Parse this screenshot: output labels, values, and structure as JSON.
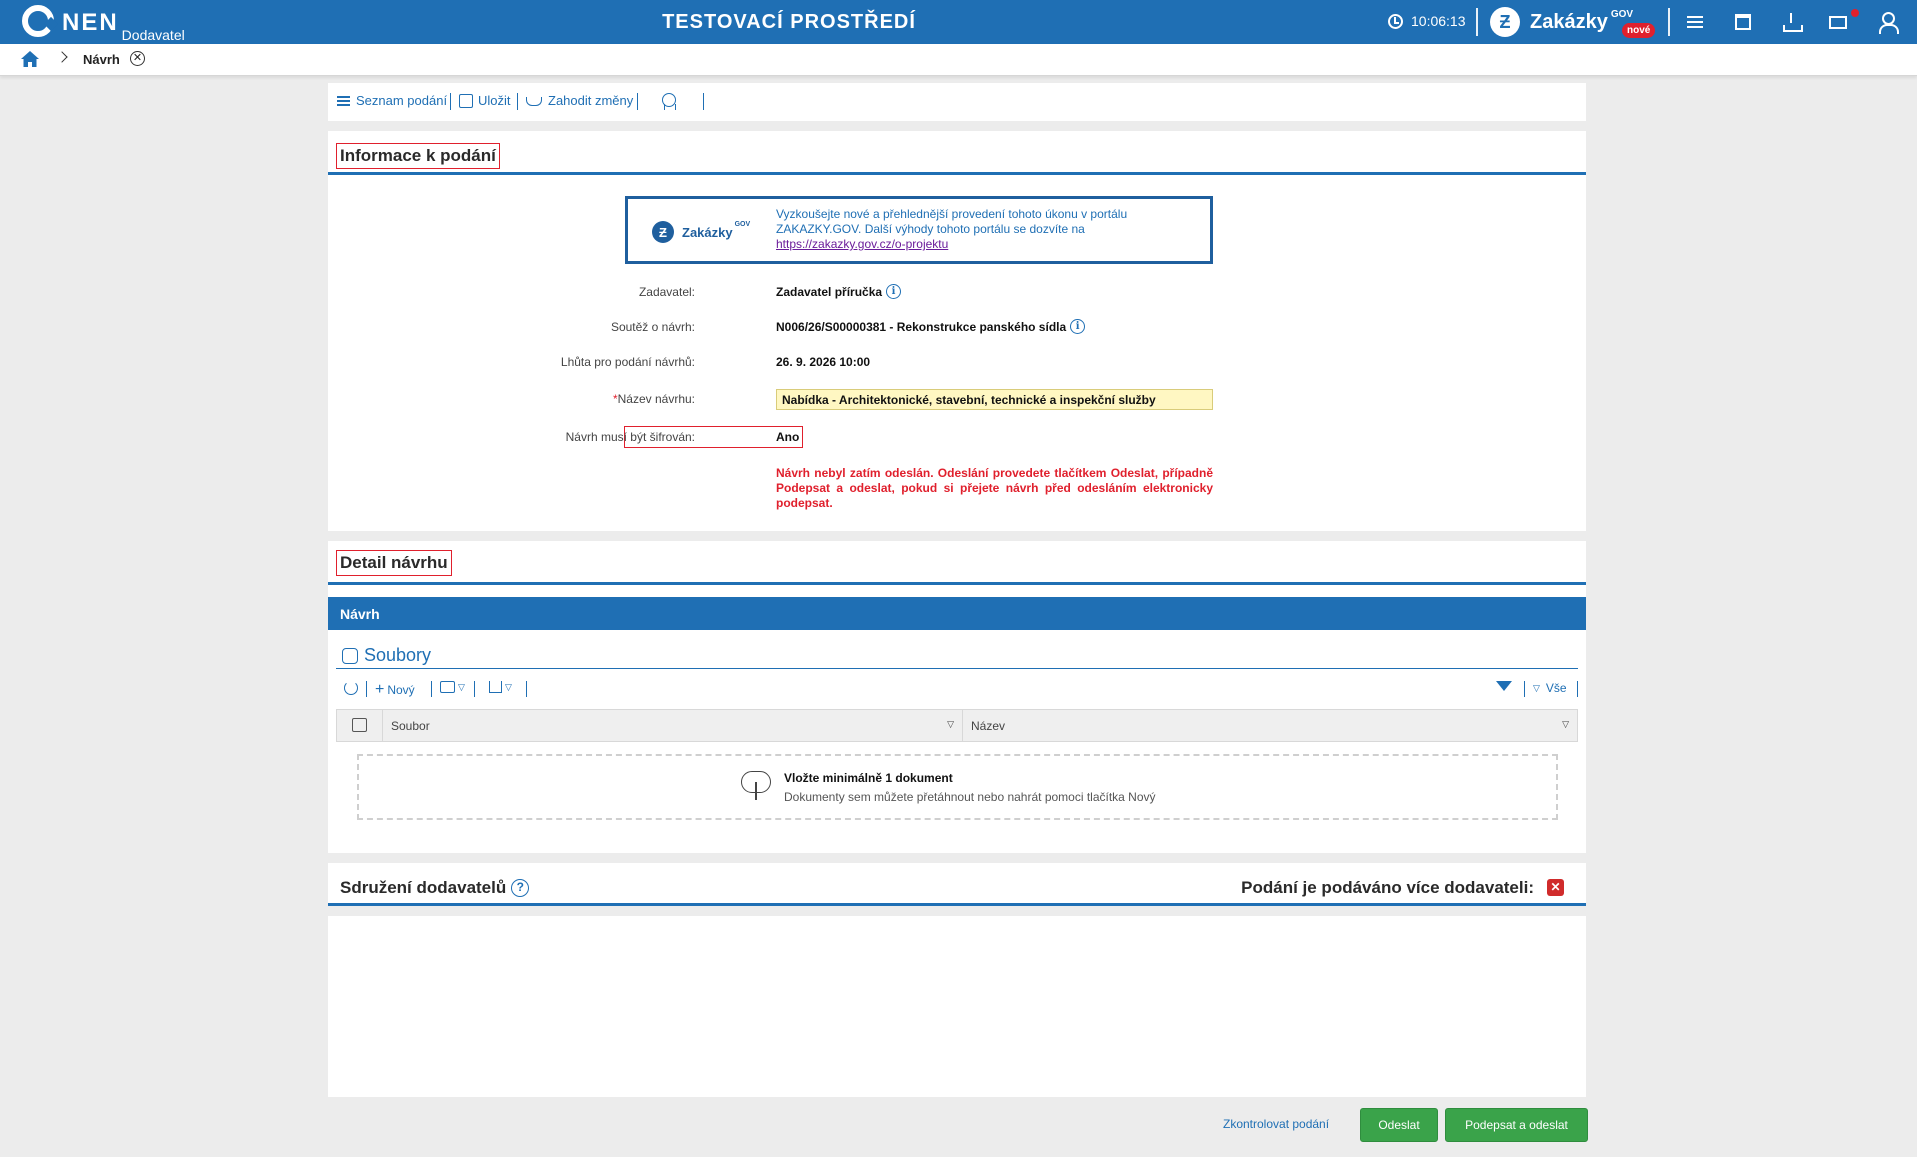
{
  "header": {
    "logo": "NEN",
    "logo_sub": "Dodavatel",
    "environment": "TESTOVACÍ PROSTŘEDÍ",
    "time": "10:06:13",
    "zakazky_name": "Zakázky",
    "zakazky_sup": "GOV",
    "zakazky_badge": "nové",
    "icons": [
      "menu-icon",
      "calendar-icon",
      "download-icon",
      "mail-icon",
      "user-icon"
    ]
  },
  "breadcrumb": {
    "current": "Návrh"
  },
  "toolbar": {
    "list_label": "Seznam podání",
    "save_label": "Uložit",
    "discard_label": "Zahodit změny"
  },
  "info": {
    "title": "Informace k podání",
    "banner": {
      "logo_name": "Zakázky",
      "logo_sup": "GOV",
      "text": "Vyzkoušejte nové a přehlednější provedení tohoto úkonu v portálu ZAKAZKY.GOV. Další výhody tohoto portálu se dozvíte na",
      "link": "https://zakazky.gov.cz/o-projektu"
    },
    "fields": {
      "zadavatel_label": "Zadavatel:",
      "zadavatel_value": "Zadavatel příručka",
      "soutez_label": "Soutěž o návrh:",
      "soutez_value": "N006/26/S00000381 - Rekonstrukce panského sídla",
      "lhuta_label": "Lhůta pro podání návrhů:",
      "lhuta_value": "26. 9. 2026 10:00",
      "nazev_label": "Název návrhu:",
      "nazev_star": "*",
      "nazev_value": "Nabídka - Architektonické, stavební, technické a inspekční služby",
      "sifrovan_label": "Návrh musí být šifrován:",
      "sifrovan_value": "Ano"
    },
    "warning": "Návrh nebyl zatím odeslán. Odeslání provedete tlačítkem Odeslat, případně Podepsat a odeslat, pokud si přejete návrh před odesláním elektronicky podepsat."
  },
  "detail": {
    "title": "Detail návrhu",
    "bar_title": "Návrh",
    "files_title": "Soubory",
    "grid_toolbar": {
      "new_label": "Nový",
      "all_label": "Vše"
    },
    "columns": [
      "Soubor",
      "Název"
    ],
    "dropzone": {
      "title": "Vložte minimálně 1 dokument",
      "subtitle": "Dokumenty sem můžete přetáhnout nebo nahrát pomoci tlačítka Nový"
    }
  },
  "association": {
    "title": "Sdružení dodavatelů",
    "help": "?",
    "question": "Podání je podáváno více dodavateli:",
    "checkbox_mark": "✕"
  },
  "actions": {
    "check_label": "Zkontrolovat podání",
    "send_label": "Odeslat",
    "sign_send_label": "Podepsat a odeslat"
  },
  "colors": {
    "primary": "#1f6fb4",
    "success": "#3aa34a",
    "danger": "#e0202d",
    "highlight_input": "#fff7c2"
  }
}
